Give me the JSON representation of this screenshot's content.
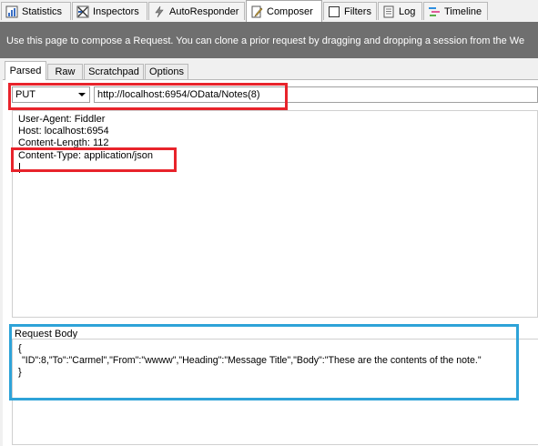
{
  "tabs": [
    {
      "id": "statistics",
      "label": "Statistics",
      "icon": "statistics-icon"
    },
    {
      "id": "inspectors",
      "label": "Inspectors",
      "icon": "inspectors-icon"
    },
    {
      "id": "autoresponder",
      "label": "AutoResponder",
      "icon": "lightning-icon"
    },
    {
      "id": "composer",
      "label": "Composer",
      "icon": "composer-icon",
      "active": true
    },
    {
      "id": "filters",
      "label": "Filters",
      "icon": "checkbox-icon"
    },
    {
      "id": "log",
      "label": "Log",
      "icon": "log-icon"
    },
    {
      "id": "timeline",
      "label": "Timeline",
      "icon": "timeline-icon"
    }
  ],
  "banner": {
    "text": "Use this page to compose a Request. You can clone a prior request by dragging and dropping a session from the We"
  },
  "subtabs": [
    {
      "label": "Parsed",
      "active": true
    },
    {
      "label": "Raw"
    },
    {
      "label": "Scratchpad"
    },
    {
      "label": "Options"
    }
  ],
  "request": {
    "method": "PUT",
    "url": "http://localhost:6954/OData/Notes(8)",
    "headers": [
      "User-Agent: Fiddler",
      "Host: localhost:6954",
      "Content-Length: 112",
      "Content-Type: application/json"
    ],
    "body_label": "Request Body",
    "body_lines": [
      "{",
      "\"ID\":8,\"To\":\"Carmel\",\"From\":\"wwww\",\"Heading\":\"Message Title\",\"Body\":\"These are the contents of the note.\"",
      "}"
    ]
  },
  "colors": {
    "highlight_red": "#e8232b",
    "highlight_blue": "#2ea3d8",
    "banner": "#6f6f6f"
  }
}
